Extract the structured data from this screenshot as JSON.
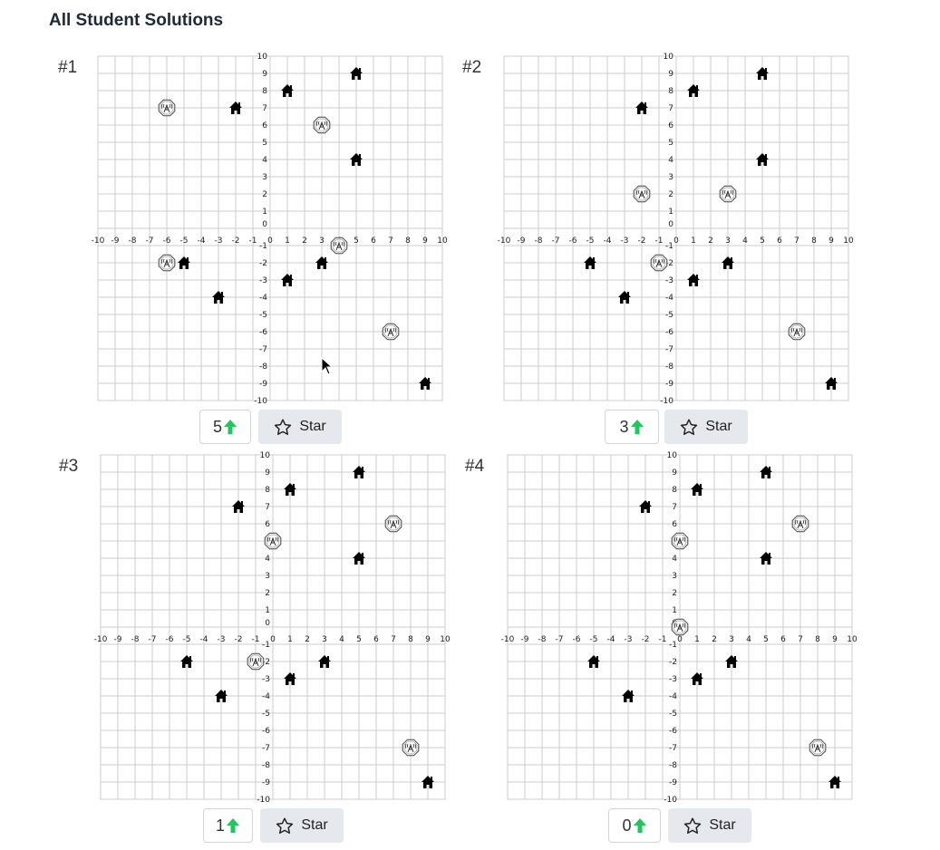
{
  "page": {
    "title": "All Student Solutions"
  },
  "grid": {
    "xmin": -10,
    "xmax": 10,
    "ymin": -10,
    "ymax": 10,
    "x_ticks": [
      "-10",
      "-9",
      "-8",
      "-7",
      "-6",
      "-5",
      "-4",
      "-3",
      "-2",
      "-1",
      "0",
      "1",
      "2",
      "3",
      "4",
      "5",
      "6",
      "7",
      "8",
      "9",
      "10"
    ],
    "y_ticks": [
      "10",
      "9",
      "8",
      "7",
      "6",
      "5",
      "4",
      "3",
      "2",
      "1",
      "0",
      "-1",
      "-2",
      "-3",
      "-4",
      "-5",
      "-6",
      "-7",
      "-8",
      "-9",
      "-10"
    ]
  },
  "houses": [
    [
      1,
      8
    ],
    [
      5,
      9
    ],
    [
      -2,
      7
    ],
    [
      5,
      4
    ],
    [
      -5,
      -2
    ],
    [
      3,
      -2
    ],
    [
      1,
      -3
    ],
    [
      -3,
      -4
    ],
    [
      9,
      -9
    ]
  ],
  "solutions": [
    {
      "label": "#1",
      "votes": "5",
      "star_label": "Star",
      "towers": [
        [
          -6,
          7
        ],
        [
          3,
          6
        ],
        [
          -6,
          -2
        ],
        [
          4,
          -1
        ],
        [
          7,
          -6
        ]
      ]
    },
    {
      "label": "#2",
      "votes": "3",
      "star_label": "Star",
      "towers": [
        [
          -2,
          2
        ],
        [
          3,
          2
        ],
        [
          -1,
          -2
        ],
        [
          7,
          -6
        ]
      ]
    },
    {
      "label": "#3",
      "votes": "1",
      "star_label": "Star",
      "towers": [
        [
          0,
          5
        ],
        [
          7,
          6
        ],
        [
          -1,
          -2
        ],
        [
          8,
          -7
        ]
      ]
    },
    {
      "label": "#4",
      "votes": "0",
      "star_label": "Star",
      "towers": [
        [
          0,
          5
        ],
        [
          7,
          6
        ],
        [
          0,
          0
        ],
        [
          8,
          -7
        ]
      ]
    }
  ],
  "icons": {
    "house": "house-icon",
    "tower": "cell-tower-icon",
    "upvote": "up-arrow-icon",
    "star": "star-outline-icon"
  },
  "colors": {
    "upvote": "#22c55e",
    "grid_line": "#cccccc",
    "star_bg": "#e5e9ee"
  }
}
